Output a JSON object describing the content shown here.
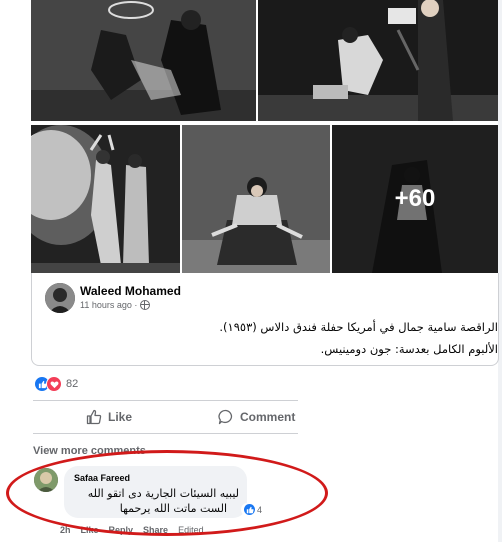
{
  "photos": {
    "more_count": "+60"
  },
  "shared_post": {
    "author": "Waleed Mohamed",
    "time": "11 hours ago ·",
    "text_line1": "الراقصة سامية جمال في أمريكا حفلة فندق دالاس (١٩٥٣).",
    "text_line2": "الألبوم الكامل بعدسة: جون دومينيس."
  },
  "reactions": {
    "count": "82"
  },
  "actions": {
    "like_label": "Like",
    "comment_label": "Comment"
  },
  "view_more": "View more comments",
  "comment": {
    "author": "Safaa Fareed",
    "line1": "ليبيه السيئات الجارية دى اتقو الله",
    "line2": "الست ماتت الله يرحمها",
    "like_count": "4",
    "time": "2h",
    "like_label": "Like",
    "reply_label": "Reply",
    "share_label": "Share",
    "edited_label": "Edited"
  },
  "colors": {
    "like_blue": "#1877f2",
    "love_red": "#f33e58",
    "annotation_red": "#d11a1a"
  }
}
